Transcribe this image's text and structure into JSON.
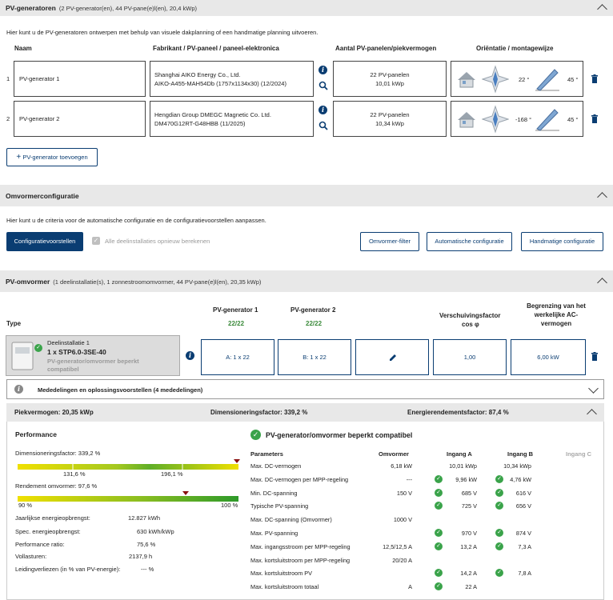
{
  "pvgen": {
    "title": "PV-generatoren",
    "subtitle": "(2 PV-generator(en), 44 PV-pane(e)l(en), 20,4 kWp)",
    "intro": "Hier kunt u de PV-generatoren ontwerpen met behulp van visuele dakplanning of een handmatige planning uitvoeren.",
    "cols": {
      "name": "Naam",
      "fab": "Fabrikant / PV-paneel / paneel-elektronica",
      "aantal": "Aantal PV-panelen/piekvermogen",
      "orient": "Oriëntatie / montagewijze"
    },
    "rows": [
      {
        "idx": "1",
        "name": "PV-generator 1",
        "fab1": "Shanghai AIKO Energy Co., Ltd.",
        "fab2": "AIKO-A455-MAH54Db (1757x1134x30) (12/2024)",
        "panels": "22 PV-panelen",
        "power": "10,01 kWp",
        "azimuth": "22 °",
        "tilt": "45 °"
      },
      {
        "idx": "2",
        "name": "PV-generator 2",
        "fab1": "Hengdian Group DMEGC Magnetic Co. Ltd.",
        "fab2": "DM470G12RT-G48HBB (11/2025)",
        "panels": "22 PV-panelen",
        "power": "10,34 kWp",
        "azimuth": "-168 °",
        "tilt": "45 °"
      }
    ],
    "add_btn": "PV-generator toevoegen"
  },
  "omv": {
    "title": "Omvormerconfiguratie",
    "intro": "Hier kunt u de criteria voor de automatische configuratie en de configuratievoorstellen aanpassen.",
    "config_btn": "Configuratievoorstellen",
    "recalc": "Alle deelinstallaties opnieuw berekenen",
    "filter_btn": "Omvormer-filter",
    "auto_btn": "Automatische configuratie",
    "manual_btn": "Handmatige configuratie"
  },
  "pvomv": {
    "title": "PV-omvormer",
    "subtitle": "(1 deelinstallatie(s), 1 zonnestroomomvormer, 44 PV-pane(e)l(en), 20,35 kWp)",
    "type_label": "Type",
    "gen1": "PV-generator 1",
    "gen1_count": "22/22",
    "gen2": "PV-generator 2",
    "gen2_count": "22/22",
    "cosphi_1": "Verschuivingsfactor",
    "cosphi_2": "cos φ",
    "limit_1": "Begrenzing van het",
    "limit_2": "werkelijke AC-",
    "limit_3": "vermogen",
    "inst_name": "Deelinstallatie 1",
    "inst_model": "1 x STP6.0-3SE-40",
    "inst_note1": "PV-generator/omvormer beperkt",
    "inst_note2": "compatibel",
    "cellA": "A: 1 x 22",
    "cellB": "B: 1 x 22",
    "cos_val": "1,00",
    "limit_val": "6,00 kW",
    "messages": "Mededelingen en oplossingsvoorstellen (4 mededelingen)",
    "peak": "Piekvermogen: 20,35 kWp",
    "dim": "Dimensioneringsfactor: 339,2 %",
    "yieldf": "Energierendementsfactor: 87,4 %"
  },
  "perf": {
    "title": "Performance",
    "dim_label": "Dimensioneringsfactor: 339,2 %",
    "dim_t1": "131,6 %",
    "dim_t2": "196,1 %",
    "eff_label": "Rendement omvormer: 97,6 %",
    "eff_t1": "90 %",
    "eff_t2": "100 %",
    "stats": [
      {
        "k": "Jaarlijkse energieopbrengst:",
        "v": "12.827 kWh"
      },
      {
        "k": "Spec. energieopbrengst:",
        "v": "630 kWh/kWp"
      },
      {
        "k": "Performance ratio:",
        "v": "75,6 %"
      },
      {
        "k": "Vollasturen:",
        "v": "2137,9  h"
      },
      {
        "k": "Leidingverliezen (in % van PV-energie):",
        "v": "--- %"
      }
    ]
  },
  "params": {
    "title": "PV-generator/omvormer beperkt compatibel",
    "h": {
      "p": "Parameters",
      "o": "Omvormer",
      "a": "Ingang A",
      "b": "Ingang B",
      "c": "Ingang C"
    },
    "rows": [
      {
        "p": "Max. DC-vermogen",
        "o": "6,18 kW",
        "a": "10,01 kWp",
        "b": "10,34 kWp",
        "ta": false,
        "tb": false
      },
      {
        "p": "Max. DC-vermogen per MPP-regeling",
        "o": "---",
        "a": "9,96 kW",
        "b": "4,76 kW",
        "ta": true,
        "tb": true
      },
      {
        "p": "Min. DC-spanning",
        "o": "150 V",
        "a": "685 V",
        "b": "616 V",
        "ta": true,
        "tb": true
      },
      {
        "p": "Typische PV-spanning",
        "o": "",
        "a": "725 V",
        "b": "656 V",
        "ta": true,
        "tb": true
      },
      {
        "p": "Max. DC-spanning (Omvormer)",
        "o": "1000 V",
        "a": "",
        "b": "",
        "ta": false,
        "tb": false
      },
      {
        "p": "Max. PV-spanning",
        "o": "",
        "a": "970 V",
        "b": "874 V",
        "ta": true,
        "tb": true
      },
      {
        "p": "Max. ingangsstroom per MPP-regeling",
        "o": "12,5/12,5 A",
        "a": "13,2 A",
        "b": "7,3 A",
        "ta": true,
        "tb": true
      },
      {
        "p": "Max. kortsluitstroom per MPP-regeling",
        "o": "20/20 A",
        "a": "",
        "b": "",
        "ta": false,
        "tb": false
      },
      {
        "p": "Max. kortsluitstroom PV",
        "o": "",
        "a": "14,2 A",
        "b": "7,8 A",
        "ta": true,
        "tb": true
      },
      {
        "p": "Max. kortsluitstroom totaal",
        "o": "A",
        "a": "22 A",
        "b": "",
        "ta": true,
        "tb": false
      }
    ]
  }
}
